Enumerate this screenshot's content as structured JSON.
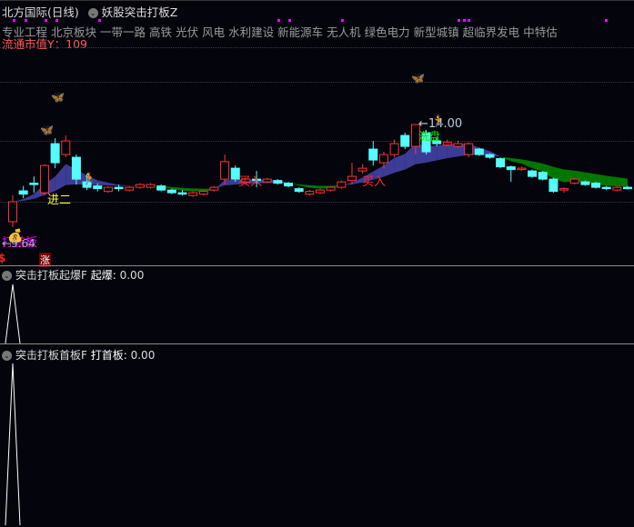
{
  "header": {
    "stock": "北方国际(日线)",
    "indicator": "妖股突击打板Z"
  },
  "concepts": [
    "专业工程",
    "北京板块",
    "一带一路",
    "高铁",
    "光伏",
    "风电",
    "水利建设",
    "新能源车",
    "无人机",
    "绿色电力",
    "新型城镇",
    "超临界发电",
    "中特估"
  ],
  "market_cap_label": "流通市值Y：",
  "market_cap_value": "109",
  "annotations": {
    "low_price": "←9.64",
    "high_price": "←14.00",
    "first_board": "打首板",
    "second_board": "进二",
    "buy": "买入",
    "wash": "洗盘",
    "limit_up": "涨",
    "dollar": "$"
  },
  "panels": [
    {
      "title": "突击打板起爆F",
      "label": "起爆:",
      "value": "0.00"
    },
    {
      "title": "突击打板首板F",
      "label": "打首板:",
      "value": "0.00"
    }
  ],
  "colors": {
    "up": "#ff3232",
    "down": "#54fcfc",
    "ribbon_up": "#3c3c96",
    "ribbon_down": "#007800",
    "marker": "#ff00ff",
    "flat": "#ffff00"
  },
  "chart_data": {
    "type": "candlestick",
    "ylim": [
      9.0,
      15.0
    ],
    "low_label": 9.64,
    "high_label": 14.0,
    "candles": [
      [
        10.44,
        11.17,
        11.41,
        10.24
      ],
      [
        11.57,
        11.45,
        11.75,
        11.3
      ],
      [
        11.85,
        11.8,
        12.1,
        11.5
      ],
      [
        11.5,
        12.5,
        12.55,
        11.4
      ],
      [
        13.3,
        12.6,
        13.5,
        12.4
      ],
      [
        12.9,
        13.4,
        13.6,
        12.8
      ],
      [
        12.8,
        12.0,
        12.9,
        11.8
      ],
      [
        11.9,
        11.7,
        12.2,
        11.6
      ],
      [
        11.75,
        11.65,
        11.85,
        11.55
      ],
      [
        11.55,
        11.7,
        11.75,
        11.5
      ],
      [
        11.7,
        11.65,
        11.8,
        11.55
      ],
      [
        11.6,
        11.7,
        11.75,
        11.55
      ],
      [
        11.7,
        11.8,
        11.85,
        11.65
      ],
      [
        11.7,
        11.8,
        11.85,
        11.65
      ],
      [
        11.75,
        11.6,
        11.8,
        11.55
      ],
      [
        11.6,
        11.5,
        11.65,
        11.45
      ],
      [
        11.5,
        11.45,
        11.6,
        11.4
      ],
      [
        11.4,
        11.5,
        11.55,
        11.35
      ],
      [
        11.45,
        11.55,
        11.6,
        11.4
      ],
      [
        11.6,
        11.7,
        11.75,
        11.55
      ],
      [
        12.0,
        12.64,
        12.9,
        11.8
      ],
      [
        12.4,
        12.0,
        12.5,
        11.9
      ],
      [
        11.9,
        12.0,
        12.05,
        11.85
      ],
      [
        12.0,
        11.95,
        12.3,
        11.7
      ],
      [
        11.9,
        12.0,
        12.05,
        11.85
      ],
      [
        11.95,
        11.85,
        12.0,
        11.8
      ],
      [
        11.85,
        11.75,
        11.9,
        11.7
      ],
      [
        11.65,
        11.55,
        11.7,
        11.5
      ],
      [
        11.45,
        11.55,
        11.6,
        11.4
      ],
      [
        11.5,
        11.6,
        11.65,
        11.45
      ],
      [
        11.6,
        11.7,
        11.75,
        11.55
      ],
      [
        11.7,
        11.9,
        11.95,
        11.65
      ],
      [
        11.95,
        12.1,
        12.6,
        11.8
      ],
      [
        12.3,
        12.4,
        12.55,
        12.2
      ],
      [
        13.1,
        12.7,
        13.4,
        12.5
      ],
      [
        12.6,
        12.9,
        13.0,
        12.4
      ],
      [
        12.9,
        13.3,
        13.45,
        12.8
      ],
      [
        13.6,
        13.2,
        13.7,
        13.1
      ],
      [
        13.2,
        14.0,
        14.0,
        12.9
      ],
      [
        13.7,
        13.0,
        13.8,
        12.9
      ],
      [
        13.4,
        13.3,
        13.5,
        13.2
      ],
      [
        13.25,
        13.35,
        13.45,
        13.2
      ],
      [
        13.2,
        13.3,
        13.4,
        13.15
      ],
      [
        12.9,
        13.3,
        13.35,
        12.8
      ],
      [
        13.1,
        12.9,
        13.15,
        12.85
      ],
      [
        12.9,
        12.8,
        12.95,
        12.75
      ],
      [
        12.75,
        12.45,
        12.8,
        12.4
      ],
      [
        12.45,
        12.35,
        12.5,
        11.9
      ],
      [
        12.35,
        12.4,
        12.45,
        12.3
      ],
      [
        12.3,
        12.1,
        12.35,
        12.05
      ],
      [
        12.25,
        12.0,
        12.3,
        11.95
      ],
      [
        12.0,
        11.55,
        12.05,
        11.5
      ],
      [
        11.6,
        11.65,
        11.7,
        11.5
      ],
      [
        11.85,
        12.0,
        12.05,
        11.8
      ],
      [
        11.9,
        11.8,
        11.95,
        11.75
      ],
      [
        11.85,
        11.7,
        11.9,
        11.65
      ],
      [
        11.7,
        11.65,
        11.75,
        11.6
      ],
      [
        11.6,
        11.7,
        11.75,
        11.55
      ],
      [
        11.7,
        11.68,
        11.75,
        11.62
      ]
    ],
    "panel_signals": [
      [
        1,
        0
      ],
      [
        1,
        0
      ]
    ]
  }
}
